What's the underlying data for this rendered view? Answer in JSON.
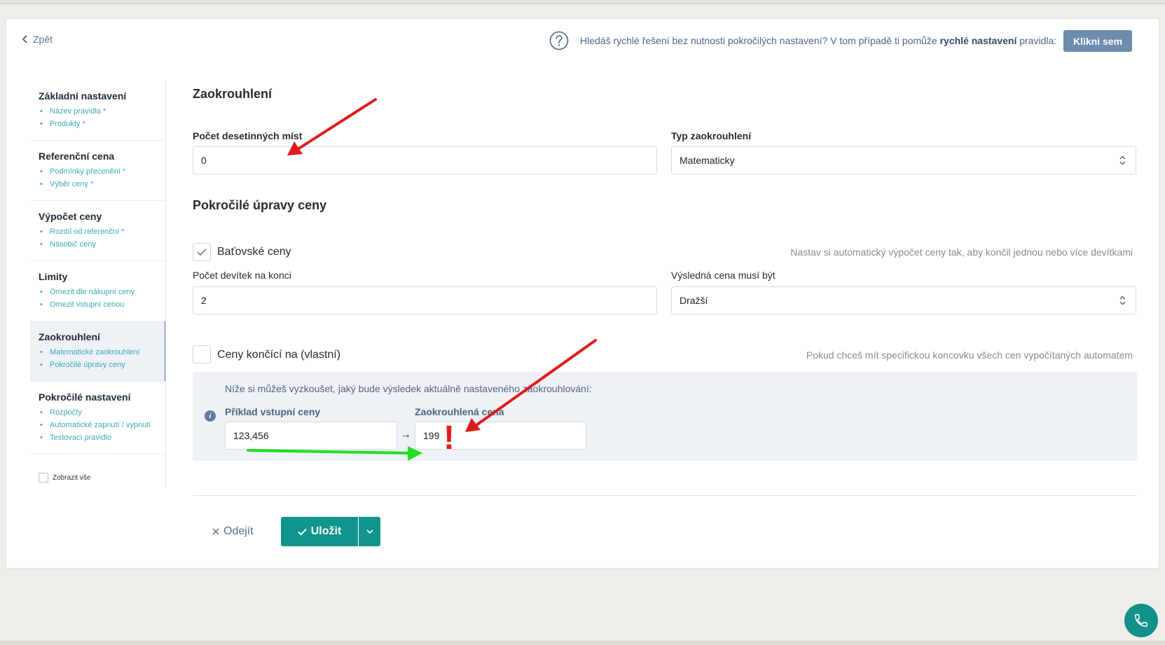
{
  "header": {
    "back_label": "Zpět",
    "help_text_before": "Hledáš rychlé řešení bez nutnosti pokročilých nastavení? V tom případě ti pomůže",
    "help_text_bold": "rychlé nastavení",
    "help_text_after": "pravidla:",
    "help_button": "Klikni sem"
  },
  "sidebar": {
    "sections": [
      {
        "title": "Základní nastavení",
        "items": [
          "Název pravidla *",
          "Produkty *"
        ]
      },
      {
        "title": "Referenční cena",
        "items": [
          "Podmínky přecenění *",
          "Výběr ceny *"
        ]
      },
      {
        "title": "Výpočet ceny",
        "items": [
          "Rozdíl od referenční *",
          "Násobič ceny"
        ]
      },
      {
        "title": "Limity",
        "items": [
          "Omezit dle nákupní ceny",
          "Omezit vstupní cenou"
        ]
      },
      {
        "title": "Zaokrouhlení",
        "items": [
          "Matematické zaokrouhlení",
          "Pokročilé úpravy ceny"
        ]
      },
      {
        "title": "Pokročilé nastavení",
        "items": [
          "Rozpočty",
          "Automatické zapnutí / vypnutí",
          "Testovací pravidlo"
        ]
      }
    ],
    "show_all_label": "Zobrazit vše"
  },
  "rounding": {
    "title": "Zaokrouhlení",
    "decimals_label": "Počet desetinných míst",
    "decimals_value": "0",
    "type_label": "Typ zaokrouhlení",
    "type_value": "Matematicky"
  },
  "advanced": {
    "title": "Pokročilé úpravy ceny",
    "bata_label": "Baťovské ceny",
    "bata_checked": true,
    "bata_hint": "Nastav si automatický výpočet ceny tak, aby končil jednou nebo více devítkami",
    "nines_label": "Počet devítek na konci",
    "nines_value": "2",
    "result_label": "Výsledná cena musí být",
    "result_value": "Dražší",
    "custom_label": "Ceny končící na (vlastní)",
    "custom_checked": false,
    "custom_hint": "Pokud chceš mít specifickou koncovku všech cen vypočítaných automatem"
  },
  "preview": {
    "intro": "Níže si můžeš vyzkoušet, jaký bude výsledek aktuálně nastaveného zaokrouhlování:",
    "input_label": "Příklad vstupní ceny",
    "input_value": "123,456",
    "arrow": "→",
    "output_label": "Zaokrouhlená cena",
    "output_value": "199"
  },
  "footer": {
    "cancel_label": "Odejít",
    "save_label": "Uložit"
  },
  "annotations": {
    "exclamation": "!"
  },
  "colors": {
    "accent": "#0f958c",
    "link": "#3aa9b8",
    "muted_blue": "#5a7290",
    "annotation_red": "#e01b1b",
    "annotation_green": "#22dd22"
  }
}
